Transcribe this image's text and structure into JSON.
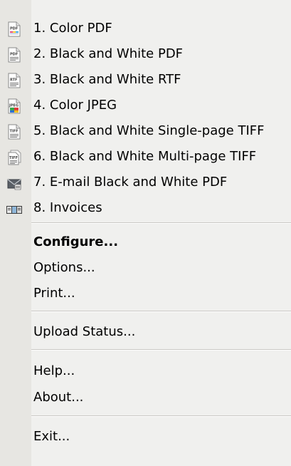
{
  "menu": {
    "profiles": [
      {
        "label": "1. Color PDF",
        "icon": "pdf-color-icon",
        "badge": "PDF"
      },
      {
        "label": "2. Black and White PDF",
        "icon": "pdf-icon",
        "badge": "PDF"
      },
      {
        "label": "3. Black and White RTF",
        "icon": "rtf-icon",
        "badge": "RTF"
      },
      {
        "label": "4. Color JPEG",
        "icon": "jpeg-icon",
        "badge": "JPEG"
      },
      {
        "label": "5. Black and White Single-page TIFF",
        "icon": "tiff-icon",
        "badge": "TIFF"
      },
      {
        "label": "6. Black and White Multi-page TIFF",
        "icon": "tiff-multipage-icon",
        "badge": "TIFF"
      },
      {
        "label": "7. E-mail Black and White PDF",
        "icon": "email-icon",
        "badge": ""
      },
      {
        "label": "8. Invoices",
        "icon": "invoices-icon",
        "badge": ""
      }
    ],
    "configure": "Configure...",
    "options": "Options...",
    "print": "Print...",
    "upload_status": "Upload Status...",
    "help": "Help...",
    "about": "About...",
    "exit": "Exit..."
  },
  "colors": {
    "menu_background": "#f0f0ee",
    "gutter_background": "#e7e6e2",
    "separator": "#c9c8c4",
    "text": "#000000"
  }
}
